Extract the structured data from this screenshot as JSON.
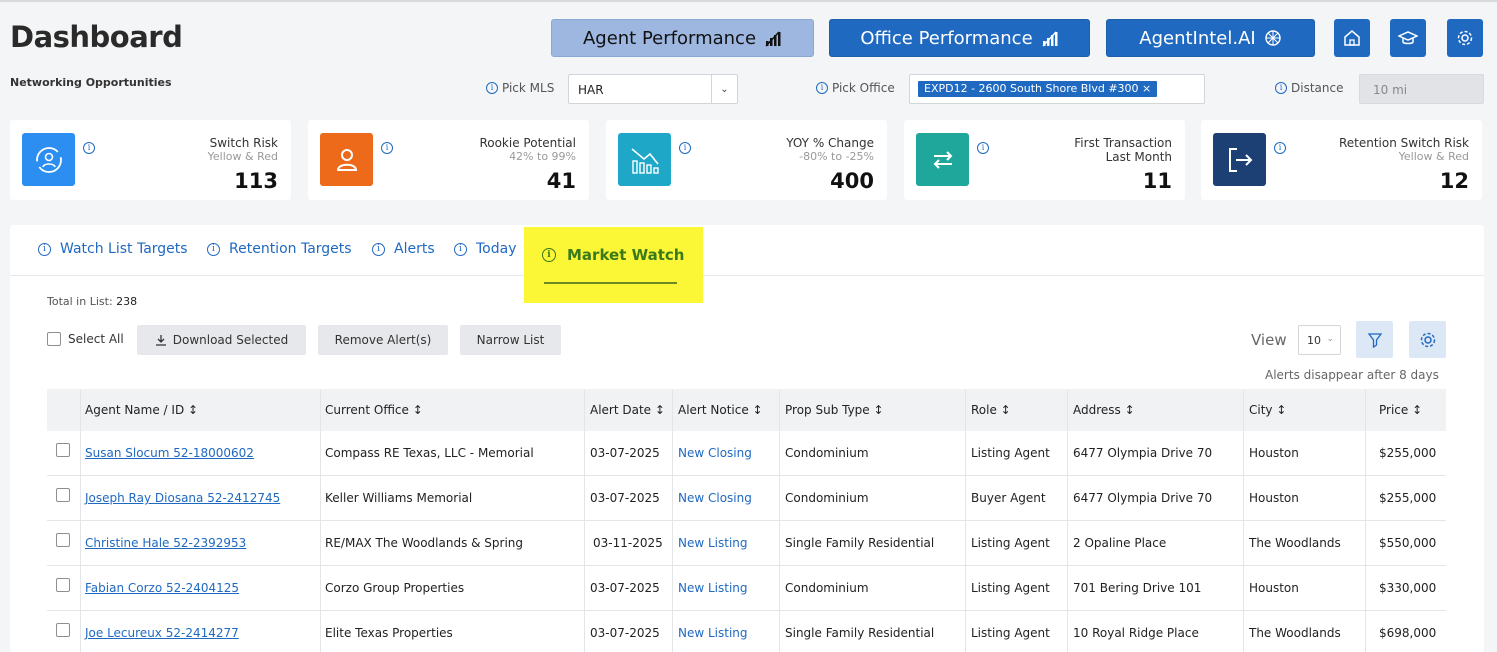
{
  "header": {
    "title": "Dashboard",
    "subtitle": "Networking Opportunities"
  },
  "nav": {
    "agent_performance": "Agent Performance",
    "office_performance": "Office Performance",
    "agentintel": "AgentIntel.AI"
  },
  "filters": {
    "mls_label": "Pick MLS",
    "mls_value": "HAR",
    "office_label": "Pick Office",
    "office_tag": "EXPD12 - 2600 South Shore Blvd #300",
    "distance_label": "Distance",
    "distance_value": "10 mi"
  },
  "cards": [
    {
      "title": "Switch Risk",
      "sub": "Yellow & Red",
      "value": "113",
      "color": "#2b8ef0",
      "icon": "user-refresh-icon"
    },
    {
      "title": "Rookie Potential",
      "sub": "42% to 99%",
      "value": "41",
      "color": "#ec6a1a",
      "icon": "user-icon"
    },
    {
      "title": "YOY % Change",
      "sub": "-80% to -25%",
      "value": "400",
      "color": "#1fa7c8",
      "icon": "chart-down-icon"
    },
    {
      "title": "First Transaction",
      "sub2": "Last Month",
      "value": "11",
      "color": "#1ea79a",
      "icon": "transfer-icon"
    },
    {
      "title": "Retention Switch Risk",
      "sub": "Yellow & Red",
      "value": "12",
      "color": "#1c3f74",
      "icon": "exit-icon"
    }
  ],
  "tabs": [
    "Watch List Targets",
    "Retention Targets",
    "Alerts",
    "Today",
    "Market Watch"
  ],
  "list": {
    "total_label": "Total in List:",
    "total": "238",
    "select_all": "Select All",
    "download": "Download Selected",
    "remove": "Remove Alert(s)",
    "narrow": "Narrow List",
    "view_label": "View",
    "view_value": "10",
    "alerts_note": "Alerts disappear after 8 days"
  },
  "columns": [
    "Agent Name / ID ↕",
    "Current Office ↕",
    "Alert Date ↕",
    "Alert Notice ↕",
    "Prop Sub Type ↕",
    "Role ↕",
    "Address ↕",
    "City ↕",
    "Price ↕"
  ],
  "rows": [
    {
      "agent": "Susan Slocum 52-18000602",
      "office": "Compass RE Texas, LLC - Memorial",
      "date": "03-07-2025",
      "notice": "New Closing",
      "type": "Condominium",
      "role": "Listing Agent",
      "address": "6477 Olympia Drive 70",
      "city": "Houston",
      "price": "$255,000"
    },
    {
      "agent": "Joseph Ray Diosana 52-2412745",
      "office": "Keller Williams Memorial",
      "date": "03-07-2025",
      "notice": "New Closing",
      "type": "Condominium",
      "role": "Buyer Agent",
      "address": "6477 Olympia Drive 70",
      "city": "Houston",
      "price": "$255,000"
    },
    {
      "agent": "Christine Hale 52-2392953",
      "office": "RE/MAX The Woodlands & Spring",
      "date": "03-11-2025",
      "notice": "New Listing",
      "type": "Single Family Residential",
      "role": "Listing Agent",
      "address": "2 Opaline Place",
      "city": "The Woodlands",
      "price": "$550,000"
    },
    {
      "agent": "Fabian Corzo 52-2404125",
      "office": "Corzo Group Properties",
      "date": "03-07-2025",
      "notice": "New Listing",
      "type": "Condominium",
      "role": "Listing Agent",
      "address": "701 Bering Drive 101",
      "city": "Houston",
      "price": "$330,000"
    },
    {
      "agent": "Joe Lecureux 52-2414277",
      "office": "Elite Texas Properties",
      "date": "03-07-2025",
      "notice": "New Listing",
      "type": "Single Family Residential",
      "role": "Listing Agent",
      "address": "10 Royal Ridge Place",
      "city": "The Woodlands",
      "price": "$698,000"
    }
  ]
}
